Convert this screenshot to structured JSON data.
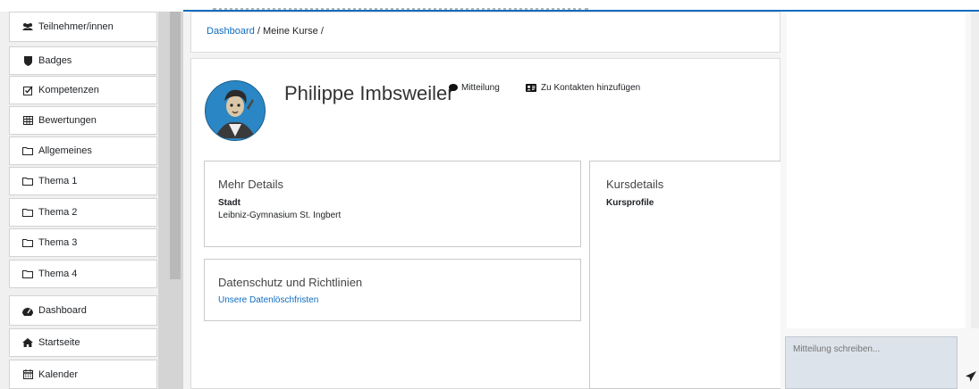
{
  "sidebar": {
    "items": [
      {
        "label": "Teilnehmer/innen",
        "icon": "users-icon"
      },
      {
        "label": "Badges",
        "icon": "shield-icon"
      },
      {
        "label": "Kompetenzen",
        "icon": "checkbox-icon"
      },
      {
        "label": "Bewertungen",
        "icon": "table-icon"
      },
      {
        "label": "Allgemeines",
        "icon": "folder-icon"
      },
      {
        "label": "Thema 1",
        "icon": "folder-icon"
      },
      {
        "label": "Thema 2",
        "icon": "folder-icon"
      },
      {
        "label": "Thema 3",
        "icon": "folder-icon"
      },
      {
        "label": "Thema 4",
        "icon": "folder-icon"
      },
      {
        "label": "Dashboard",
        "icon": "dashboard-icon"
      },
      {
        "label": "Startseite",
        "icon": "home-icon"
      },
      {
        "label": "Kalender",
        "icon": "calendar-icon"
      }
    ]
  },
  "breadcrumb": {
    "dashboard": "Dashboard",
    "sep1": "/",
    "courses": "Meine Kurse",
    "sep2": "/"
  },
  "profile": {
    "name": "Philippe Imbsweiler",
    "message_label": "Mitteilung",
    "add_contact_label": "Zu Kontakten hinzufügen"
  },
  "details": {
    "title": "Mehr Details",
    "city_label": "Stadt",
    "city_value": "Leibniz-Gymnasium St. Ingbert"
  },
  "privacy": {
    "title": "Datenschutz und Richtlinien",
    "link": "Unsere Datenlöschfristen"
  },
  "course": {
    "title": "Kursdetails",
    "profiles_label": "Kursprofile"
  },
  "messaging": {
    "placeholder": "Mitteilung schreiben..."
  },
  "colors": {
    "accent": "#0f6cbf",
    "avatar_bg": "#2a86c4",
    "compose_bg": "#dce3ea"
  }
}
